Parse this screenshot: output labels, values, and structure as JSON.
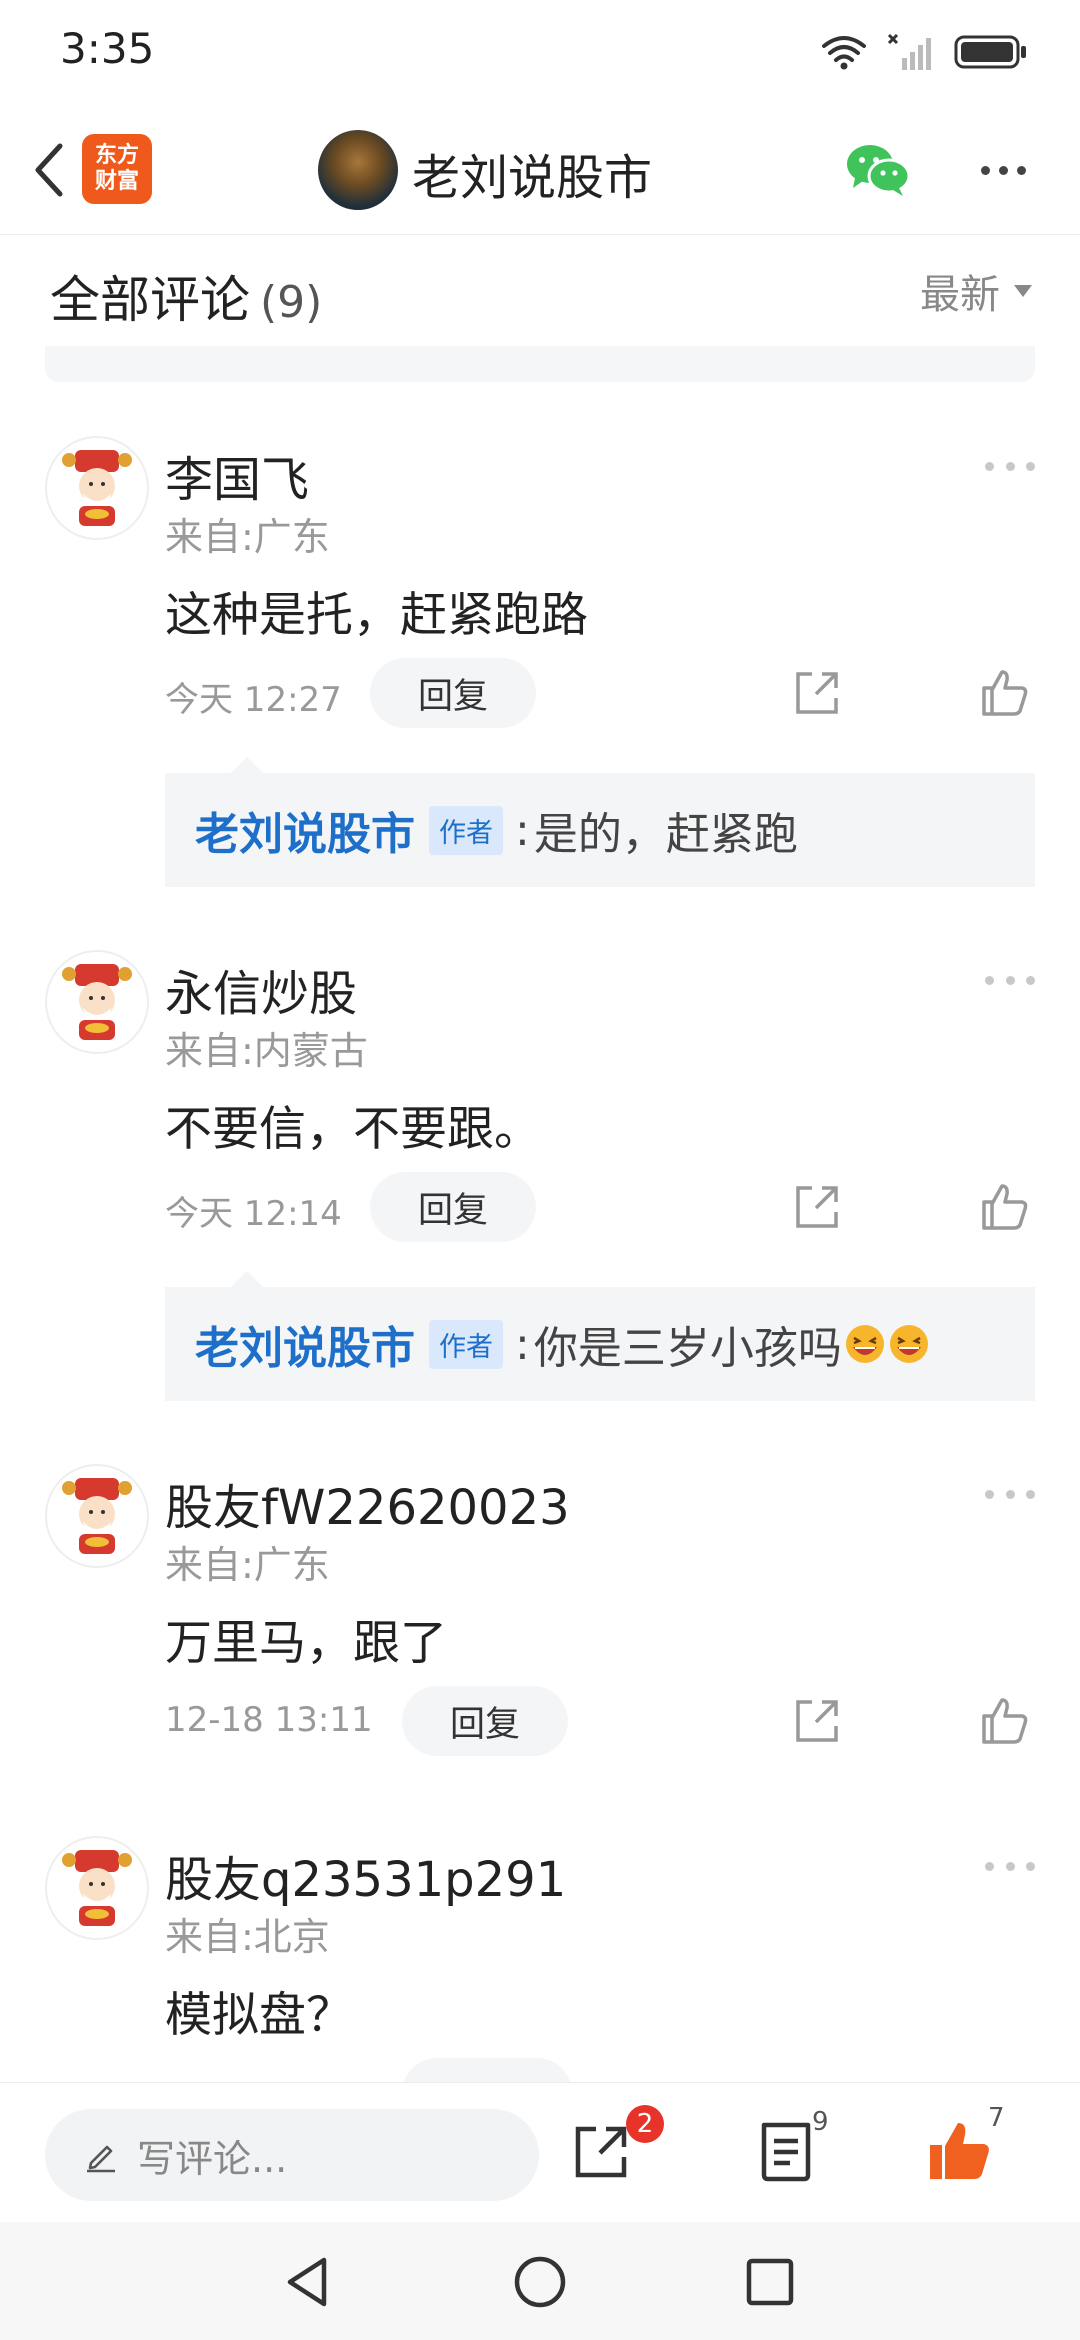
{
  "status_bar": {
    "time": "3:35"
  },
  "header": {
    "logo_line1": "东方",
    "logo_line2": "财富",
    "author_name": "老刘说股市"
  },
  "section": {
    "title": "全部评论",
    "count": "(9)",
    "sort_label": "最新"
  },
  "comments": [
    {
      "name": "李国飞",
      "location": "来自:广东",
      "text": "这种是托，赶紧跑路",
      "time": "今天 12:27",
      "reply_label": "回复",
      "reply": {
        "author": "老刘说股市",
        "badge": "作者",
        "colon": ":",
        "text": "是的，赶紧跑"
      }
    },
    {
      "name": "永信炒股",
      "location": "来自:内蒙古",
      "text": "不要信，不要跟。",
      "time": "今天 12:14",
      "reply_label": "回复",
      "reply": {
        "author": "老刘说股市",
        "badge": "作者",
        "colon": ":",
        "text": "你是三岁小孩吗"
      }
    },
    {
      "name": "股友fW22620023",
      "location": "来自:广东",
      "text": "万里马，跟了",
      "time": "12-18 13:11",
      "reply_label": "回复"
    },
    {
      "name": "股友q23531p291",
      "location": "来自:北京",
      "text": "模拟盘？"
    }
  ],
  "bottom_bar": {
    "write_placeholder": "写评论...",
    "share_badge": "2",
    "article_count": "9",
    "like_count": "7"
  },
  "colors": {
    "accent_blue": "#1e6fc9",
    "brand_orange": "#ef5a1c",
    "badge_red": "#e8332a",
    "like_orange": "#f0601f"
  }
}
